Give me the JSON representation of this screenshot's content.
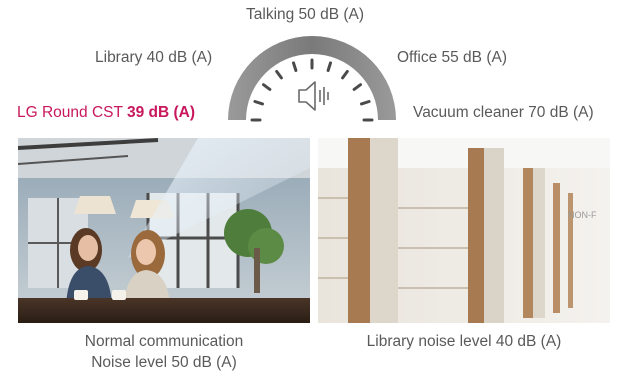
{
  "gauge": {
    "talking": "Talking 50 dB (A)",
    "library": "Library 40 dB (A)",
    "office": "Office 55 dB (A)",
    "lg_prefix": "LG Round CST ",
    "lg_value": "39 dB (A)",
    "vacuum": "Vacuum cleaner 70 dB (A)",
    "icon": "speaker-icon",
    "accent_color": "#c8175d",
    "arc_color": "#8a8a8a"
  },
  "photos": [
    {
      "name": "cafe-photo",
      "caption_line1": "Normal communication",
      "caption_line2": "Noise level 50 dB (A)"
    },
    {
      "name": "library-photo",
      "caption_line1": "Library noise level 40 dB (A)",
      "sign_text": "NON-F"
    }
  ]
}
